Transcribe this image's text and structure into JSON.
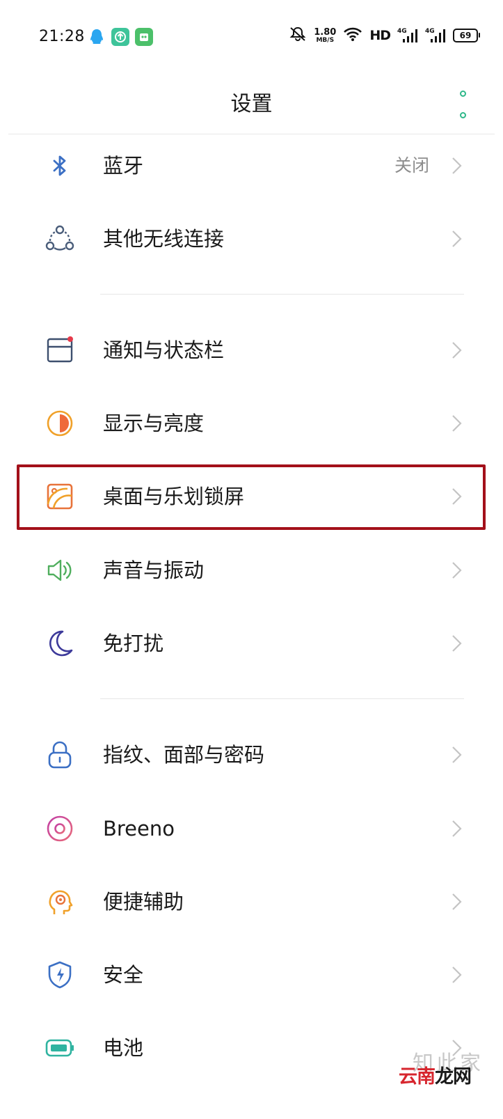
{
  "status_bar": {
    "time": "21:28",
    "speed_value": "1.80",
    "speed_unit": "MB/S",
    "hd_label": "HD",
    "net1": "4G",
    "net2": "4G",
    "battery": "69"
  },
  "header": {
    "title": "设置"
  },
  "items": [
    {
      "label": "蓝牙",
      "value": "关闭",
      "icon": "bluetooth-icon",
      "color": "#3b6fc4"
    },
    {
      "label": "其他无线连接",
      "icon": "connections-icon",
      "color": "#4a5d7a"
    },
    {
      "label": "通知与状态栏",
      "icon": "notification-icon",
      "color": "#3d4f6e"
    },
    {
      "label": "显示与亮度",
      "icon": "brightness-icon",
      "color": "#f0a12a"
    },
    {
      "label": "桌面与乐划锁屏",
      "icon": "wallpaper-icon",
      "color": "#e8733a"
    },
    {
      "label": "声音与振动",
      "icon": "sound-icon",
      "color": "#4fae5d"
    },
    {
      "label": "免打扰",
      "icon": "moon-icon",
      "color": "#3d3a9a"
    },
    {
      "label": "指纹、面部与密码",
      "icon": "lock-icon",
      "color": "#3b6fc4"
    },
    {
      "label": "Breeno",
      "icon": "breeno-icon",
      "color": "#c23fa5"
    },
    {
      "label": "便捷辅助",
      "icon": "assist-icon",
      "color": "#f0a12a"
    },
    {
      "label": "安全",
      "icon": "shield-icon",
      "color": "#3b6fc4"
    },
    {
      "label": "电池",
      "icon": "battery-icon",
      "color": "#2fb3a0"
    }
  ],
  "watermark": {
    "line1": "知此家",
    "line2a": "云南",
    "line2b": "龙网"
  },
  "colors": {
    "highlight": "#a3101a",
    "accent": "#2fb88a"
  }
}
